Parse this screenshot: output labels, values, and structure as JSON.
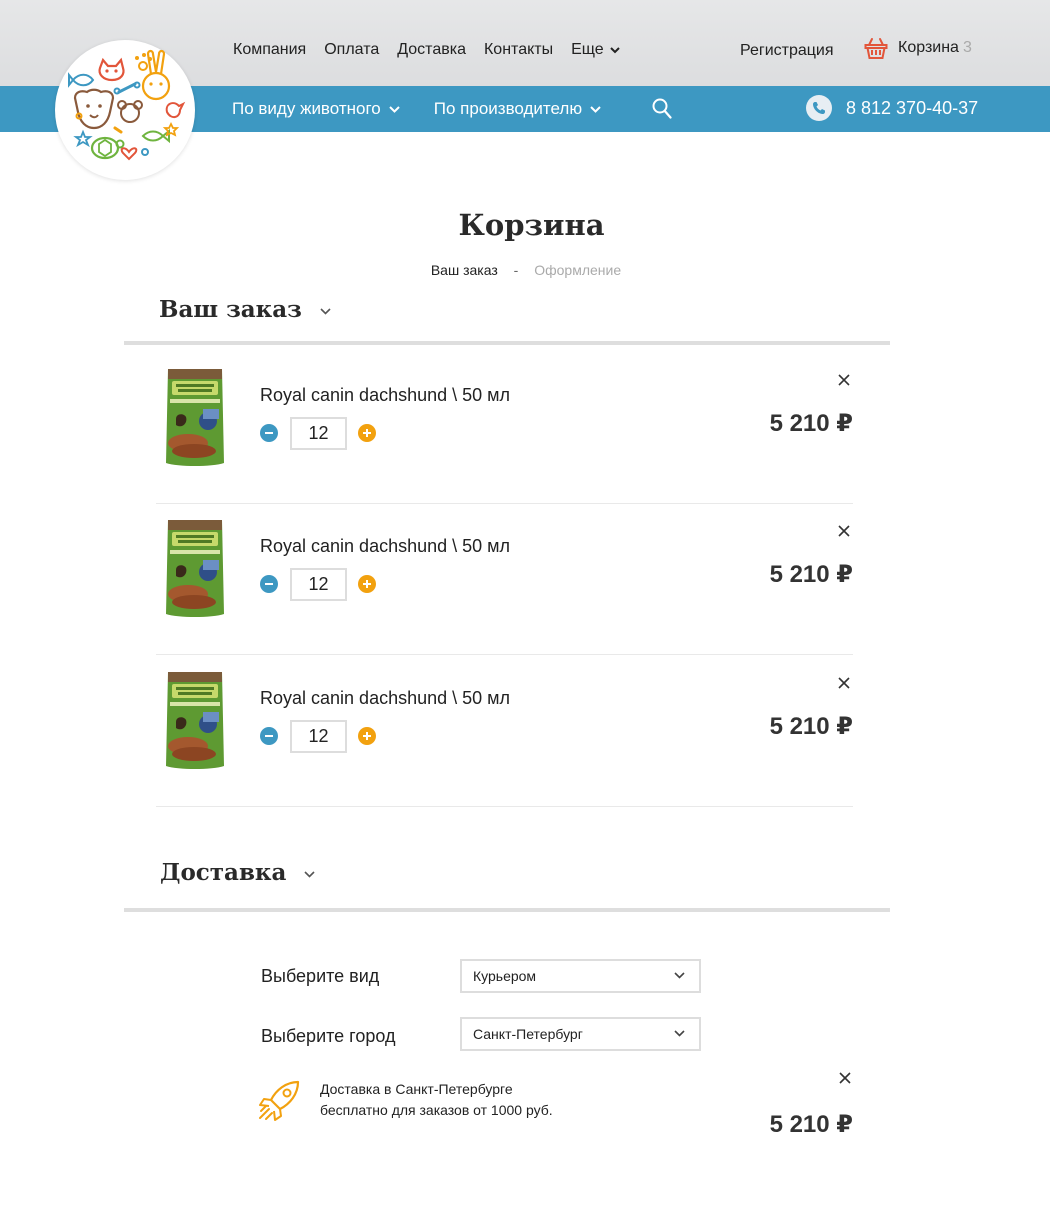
{
  "header": {
    "top_nav": [
      {
        "label": "Компания"
      },
      {
        "label": "Оплата"
      },
      {
        "label": "Доставка"
      },
      {
        "label": "Контакты"
      },
      {
        "label": "Еще",
        "dropdown": true
      }
    ],
    "register_label": "Регистрация",
    "cart_label": "Корзина",
    "cart_count": "3",
    "category_nav": [
      {
        "label": "По виду животного"
      },
      {
        "label": "По производителю"
      }
    ],
    "phone": "8 812 370-40-37"
  },
  "colors": {
    "brand_blue": "#3d98c2",
    "accent_orange": "#f2a10f",
    "cart_icon": "#e2553a"
  },
  "page": {
    "title": "Корзина",
    "steps": {
      "current": "Ваш заказ",
      "separator": "-",
      "next": "Оформление"
    }
  },
  "order": {
    "title": "Ваш заказ",
    "items": [
      {
        "name": "Royal canin dachshund \\ 50 мл",
        "qty": "12",
        "price": "5 210 ₽"
      },
      {
        "name": "Royal canin dachshund \\ 50 мл",
        "qty": "12",
        "price": "5 210 ₽"
      },
      {
        "name": "Royal canin dachshund \\ 50 мл",
        "qty": "12",
        "price": "5 210 ₽"
      }
    ]
  },
  "delivery": {
    "title": "Доставка",
    "type_label": "Выберите вид",
    "type_value": "Курьером",
    "city_label": "Выберите город",
    "city_value": "Санкт-Петербург",
    "promo_line1": "Доставка в Санкт-Петербурге",
    "promo_line2": "бесплатно для заказов от 1000 руб.",
    "price": "5 210 ₽"
  }
}
